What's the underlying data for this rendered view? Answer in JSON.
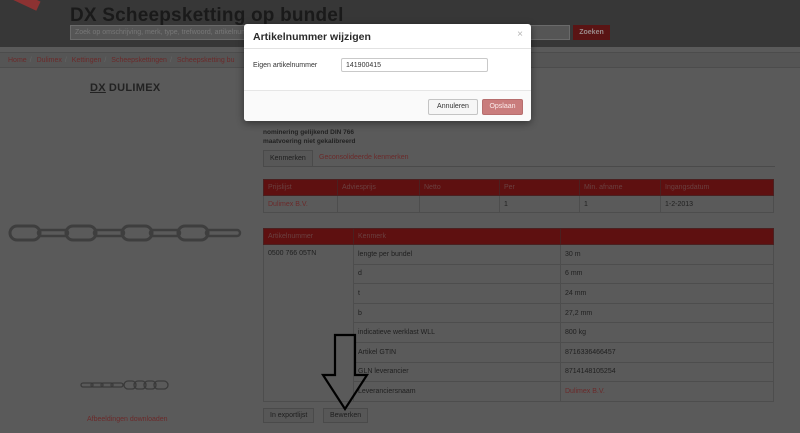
{
  "header": {
    "title": "DX Scheepsketting op bundel",
    "search_placeholder": "Zoek op omschrijving, merk, type, trefwoord, artikelnummer",
    "search_button": "Zoeken"
  },
  "breadcrumb": [
    "Home",
    "Dulimex",
    "Kettingen",
    "Scheepskettingen",
    "Scheepsketting bu"
  ],
  "left_panel": {
    "brand_prefix": "DX",
    "brand_name": "DULIMEX",
    "download_label": "Afbeeldingen downloaden"
  },
  "product": {
    "line1": "nominering gelijkend DIN 766",
    "line2": "maatvoering niet gekalibreerd"
  },
  "tabs": [
    "Kenmerken",
    "Geconsolideerde kenmerken"
  ],
  "price_table": {
    "headers": [
      "Prijslijst",
      "Adviesprijs",
      "Netto",
      "Per",
      "Min. afname",
      "Ingangsdatum"
    ],
    "rows": [
      [
        "Dulimex B.V.",
        "",
        "",
        "1",
        "1",
        "1-2-2013"
      ]
    ]
  },
  "spec_table": {
    "headers": [
      "Artikelnummer",
      "Kenmerk",
      ""
    ],
    "article_number": "0500 766 05TN",
    "rows": [
      [
        "lengte per bundel",
        "30 m"
      ],
      [
        "d",
        "6 mm"
      ],
      [
        "t",
        "24 mm"
      ],
      [
        "b",
        "27,2 mm"
      ],
      [
        "indicatieve werklast WLL",
        "800 kg"
      ],
      [
        "Artikel GTIN",
        "8716336466457"
      ],
      [
        "GLN leverancier",
        "8714148105254"
      ],
      [
        "Leveranciersnaam",
        "Dulimex B.V."
      ]
    ]
  },
  "bottom_buttons": {
    "export_label": "In exportlijst",
    "edit_label": "Bewerken"
  },
  "modal": {
    "title": "Artikelnummer wijzigen",
    "close_glyph": "×",
    "field_label": "Eigen artikelnummer",
    "field_value": "141900415",
    "cancel_label": "Annuleren",
    "save_label": "Opslaan"
  }
}
